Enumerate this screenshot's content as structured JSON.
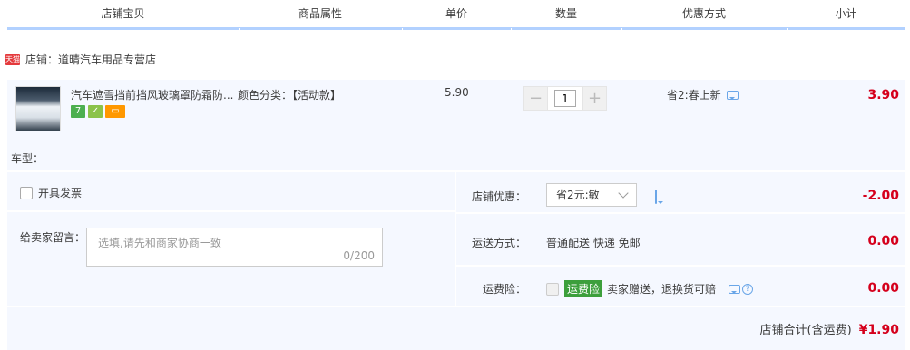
{
  "header": {
    "shop_item": "店铺宝贝",
    "attributes": "商品属性",
    "unit_price": "单价",
    "quantity": "数量",
    "discount": "优惠方式",
    "subtotal": "小计"
  },
  "shop": {
    "badge": "天猫",
    "name": "店铺：道晴汽车用品专营店"
  },
  "item": {
    "title": "汽车遮雪挡前挡风玻璃罩防霜防...",
    "badges": [
      {
        "text": "7",
        "color": "#4caf50",
        "icon": "seven-day-return-icon"
      },
      {
        "text": "✓",
        "color": "#8bc34a",
        "icon": "guarantee-icon"
      },
      {
        "text": "▭",
        "color": "#ff9800",
        "icon": "credit-card-icon"
      }
    ],
    "attribute": "颜色分类：【活动款】",
    "price": "5.90",
    "quantity": "1",
    "minus": "−",
    "plus": "+",
    "promo": "省2:春上新",
    "subtotal": "3.90",
    "car_type": "车型："
  },
  "invoice": {
    "label": "开具发票"
  },
  "message": {
    "label": "给卖家留言：",
    "placeholder": "选填,请先和商家协商一致",
    "counter": "0/200"
  },
  "shop_discount": {
    "label": "店铺优惠：",
    "selected": "省2元:敏",
    "amount": "-2.00"
  },
  "shipping": {
    "label": "运送方式：",
    "value": "普通配送 快递 免邮",
    "amount": "0.00"
  },
  "insurance": {
    "label": "运费险：",
    "badge": "运费险",
    "desc": "卖家赠送，退换货可赔",
    "amount": "0.00",
    "help": "?"
  },
  "total": {
    "label": "店铺合计(含运费)",
    "amount": "¥1.90"
  },
  "colors": {
    "accent_red": "#d5001c",
    "header_line": "#b2d1ff",
    "panel_bg": "#f5f8ff",
    "tmall_red": "#e4393c",
    "insurance_green": "#3c9f3c"
  }
}
